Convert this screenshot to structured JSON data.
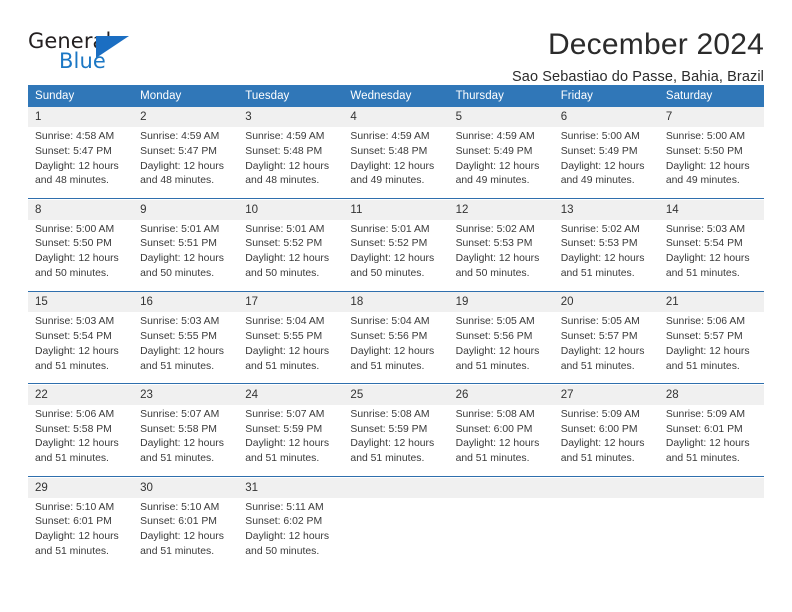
{
  "brand": {
    "name_dark": "General",
    "name_blue": "Blue",
    "color_dark": "#231f20",
    "color_blue": "#1b77c4",
    "triangle_color": "#1b6ec2"
  },
  "header": {
    "title": "December 2024",
    "subtitle": "Sao Sebastiao do Passe, Bahia, Brazil",
    "header_bg": "#3077b8",
    "header_text": "#ffffff",
    "daynum_bg": "#f0f0f0",
    "separator": "#2f6fad"
  },
  "weekday_headers": [
    "Sunday",
    "Monday",
    "Tuesday",
    "Wednesday",
    "Thursday",
    "Friday",
    "Saturday"
  ],
  "weeks": [
    {
      "days": [
        {
          "num": "1",
          "sunrise": "Sunrise: 4:58 AM",
          "sunset": "Sunset: 5:47 PM",
          "daylight1": "Daylight: 12 hours",
          "daylight2": "and 48 minutes."
        },
        {
          "num": "2",
          "sunrise": "Sunrise: 4:59 AM",
          "sunset": "Sunset: 5:47 PM",
          "daylight1": "Daylight: 12 hours",
          "daylight2": "and 48 minutes."
        },
        {
          "num": "3",
          "sunrise": "Sunrise: 4:59 AM",
          "sunset": "Sunset: 5:48 PM",
          "daylight1": "Daylight: 12 hours",
          "daylight2": "and 48 minutes."
        },
        {
          "num": "4",
          "sunrise": "Sunrise: 4:59 AM",
          "sunset": "Sunset: 5:48 PM",
          "daylight1": "Daylight: 12 hours",
          "daylight2": "and 49 minutes."
        },
        {
          "num": "5",
          "sunrise": "Sunrise: 4:59 AM",
          "sunset": "Sunset: 5:49 PM",
          "daylight1": "Daylight: 12 hours",
          "daylight2": "and 49 minutes."
        },
        {
          "num": "6",
          "sunrise": "Sunrise: 5:00 AM",
          "sunset": "Sunset: 5:49 PM",
          "daylight1": "Daylight: 12 hours",
          "daylight2": "and 49 minutes."
        },
        {
          "num": "7",
          "sunrise": "Sunrise: 5:00 AM",
          "sunset": "Sunset: 5:50 PM",
          "daylight1": "Daylight: 12 hours",
          "daylight2": "and 49 minutes."
        }
      ]
    },
    {
      "days": [
        {
          "num": "8",
          "sunrise": "Sunrise: 5:00 AM",
          "sunset": "Sunset: 5:50 PM",
          "daylight1": "Daylight: 12 hours",
          "daylight2": "and 50 minutes."
        },
        {
          "num": "9",
          "sunrise": "Sunrise: 5:01 AM",
          "sunset": "Sunset: 5:51 PM",
          "daylight1": "Daylight: 12 hours",
          "daylight2": "and 50 minutes."
        },
        {
          "num": "10",
          "sunrise": "Sunrise: 5:01 AM",
          "sunset": "Sunset: 5:52 PM",
          "daylight1": "Daylight: 12 hours",
          "daylight2": "and 50 minutes."
        },
        {
          "num": "11",
          "sunrise": "Sunrise: 5:01 AM",
          "sunset": "Sunset: 5:52 PM",
          "daylight1": "Daylight: 12 hours",
          "daylight2": "and 50 minutes."
        },
        {
          "num": "12",
          "sunrise": "Sunrise: 5:02 AM",
          "sunset": "Sunset: 5:53 PM",
          "daylight1": "Daylight: 12 hours",
          "daylight2": "and 50 minutes."
        },
        {
          "num": "13",
          "sunrise": "Sunrise: 5:02 AM",
          "sunset": "Sunset: 5:53 PM",
          "daylight1": "Daylight: 12 hours",
          "daylight2": "and 51 minutes."
        },
        {
          "num": "14",
          "sunrise": "Sunrise: 5:03 AM",
          "sunset": "Sunset: 5:54 PM",
          "daylight1": "Daylight: 12 hours",
          "daylight2": "and 51 minutes."
        }
      ]
    },
    {
      "days": [
        {
          "num": "15",
          "sunrise": "Sunrise: 5:03 AM",
          "sunset": "Sunset: 5:54 PM",
          "daylight1": "Daylight: 12 hours",
          "daylight2": "and 51 minutes."
        },
        {
          "num": "16",
          "sunrise": "Sunrise: 5:03 AM",
          "sunset": "Sunset: 5:55 PM",
          "daylight1": "Daylight: 12 hours",
          "daylight2": "and 51 minutes."
        },
        {
          "num": "17",
          "sunrise": "Sunrise: 5:04 AM",
          "sunset": "Sunset: 5:55 PM",
          "daylight1": "Daylight: 12 hours",
          "daylight2": "and 51 minutes."
        },
        {
          "num": "18",
          "sunrise": "Sunrise: 5:04 AM",
          "sunset": "Sunset: 5:56 PM",
          "daylight1": "Daylight: 12 hours",
          "daylight2": "and 51 minutes."
        },
        {
          "num": "19",
          "sunrise": "Sunrise: 5:05 AM",
          "sunset": "Sunset: 5:56 PM",
          "daylight1": "Daylight: 12 hours",
          "daylight2": "and 51 minutes."
        },
        {
          "num": "20",
          "sunrise": "Sunrise: 5:05 AM",
          "sunset": "Sunset: 5:57 PM",
          "daylight1": "Daylight: 12 hours",
          "daylight2": "and 51 minutes."
        },
        {
          "num": "21",
          "sunrise": "Sunrise: 5:06 AM",
          "sunset": "Sunset: 5:57 PM",
          "daylight1": "Daylight: 12 hours",
          "daylight2": "and 51 minutes."
        }
      ]
    },
    {
      "days": [
        {
          "num": "22",
          "sunrise": "Sunrise: 5:06 AM",
          "sunset": "Sunset: 5:58 PM",
          "daylight1": "Daylight: 12 hours",
          "daylight2": "and 51 minutes."
        },
        {
          "num": "23",
          "sunrise": "Sunrise: 5:07 AM",
          "sunset": "Sunset: 5:58 PM",
          "daylight1": "Daylight: 12 hours",
          "daylight2": "and 51 minutes."
        },
        {
          "num": "24",
          "sunrise": "Sunrise: 5:07 AM",
          "sunset": "Sunset: 5:59 PM",
          "daylight1": "Daylight: 12 hours",
          "daylight2": "and 51 minutes."
        },
        {
          "num": "25",
          "sunrise": "Sunrise: 5:08 AM",
          "sunset": "Sunset: 5:59 PM",
          "daylight1": "Daylight: 12 hours",
          "daylight2": "and 51 minutes."
        },
        {
          "num": "26",
          "sunrise": "Sunrise: 5:08 AM",
          "sunset": "Sunset: 6:00 PM",
          "daylight1": "Daylight: 12 hours",
          "daylight2": "and 51 minutes."
        },
        {
          "num": "27",
          "sunrise": "Sunrise: 5:09 AM",
          "sunset": "Sunset: 6:00 PM",
          "daylight1": "Daylight: 12 hours",
          "daylight2": "and 51 minutes."
        },
        {
          "num": "28",
          "sunrise": "Sunrise: 5:09 AM",
          "sunset": "Sunset: 6:01 PM",
          "daylight1": "Daylight: 12 hours",
          "daylight2": "and 51 minutes."
        }
      ]
    },
    {
      "days": [
        {
          "num": "29",
          "sunrise": "Sunrise: 5:10 AM",
          "sunset": "Sunset: 6:01 PM",
          "daylight1": "Daylight: 12 hours",
          "daylight2": "and 51 minutes."
        },
        {
          "num": "30",
          "sunrise": "Sunrise: 5:10 AM",
          "sunset": "Sunset: 6:01 PM",
          "daylight1": "Daylight: 12 hours",
          "daylight2": "and 51 minutes."
        },
        {
          "num": "31",
          "sunrise": "Sunrise: 5:11 AM",
          "sunset": "Sunset: 6:02 PM",
          "daylight1": "Daylight: 12 hours",
          "daylight2": "and 50 minutes."
        },
        {
          "num": "",
          "sunrise": "",
          "sunset": "",
          "daylight1": "",
          "daylight2": ""
        },
        {
          "num": "",
          "sunrise": "",
          "sunset": "",
          "daylight1": "",
          "daylight2": ""
        },
        {
          "num": "",
          "sunrise": "",
          "sunset": "",
          "daylight1": "",
          "daylight2": ""
        },
        {
          "num": "",
          "sunrise": "",
          "sunset": "",
          "daylight1": "",
          "daylight2": ""
        }
      ]
    }
  ]
}
